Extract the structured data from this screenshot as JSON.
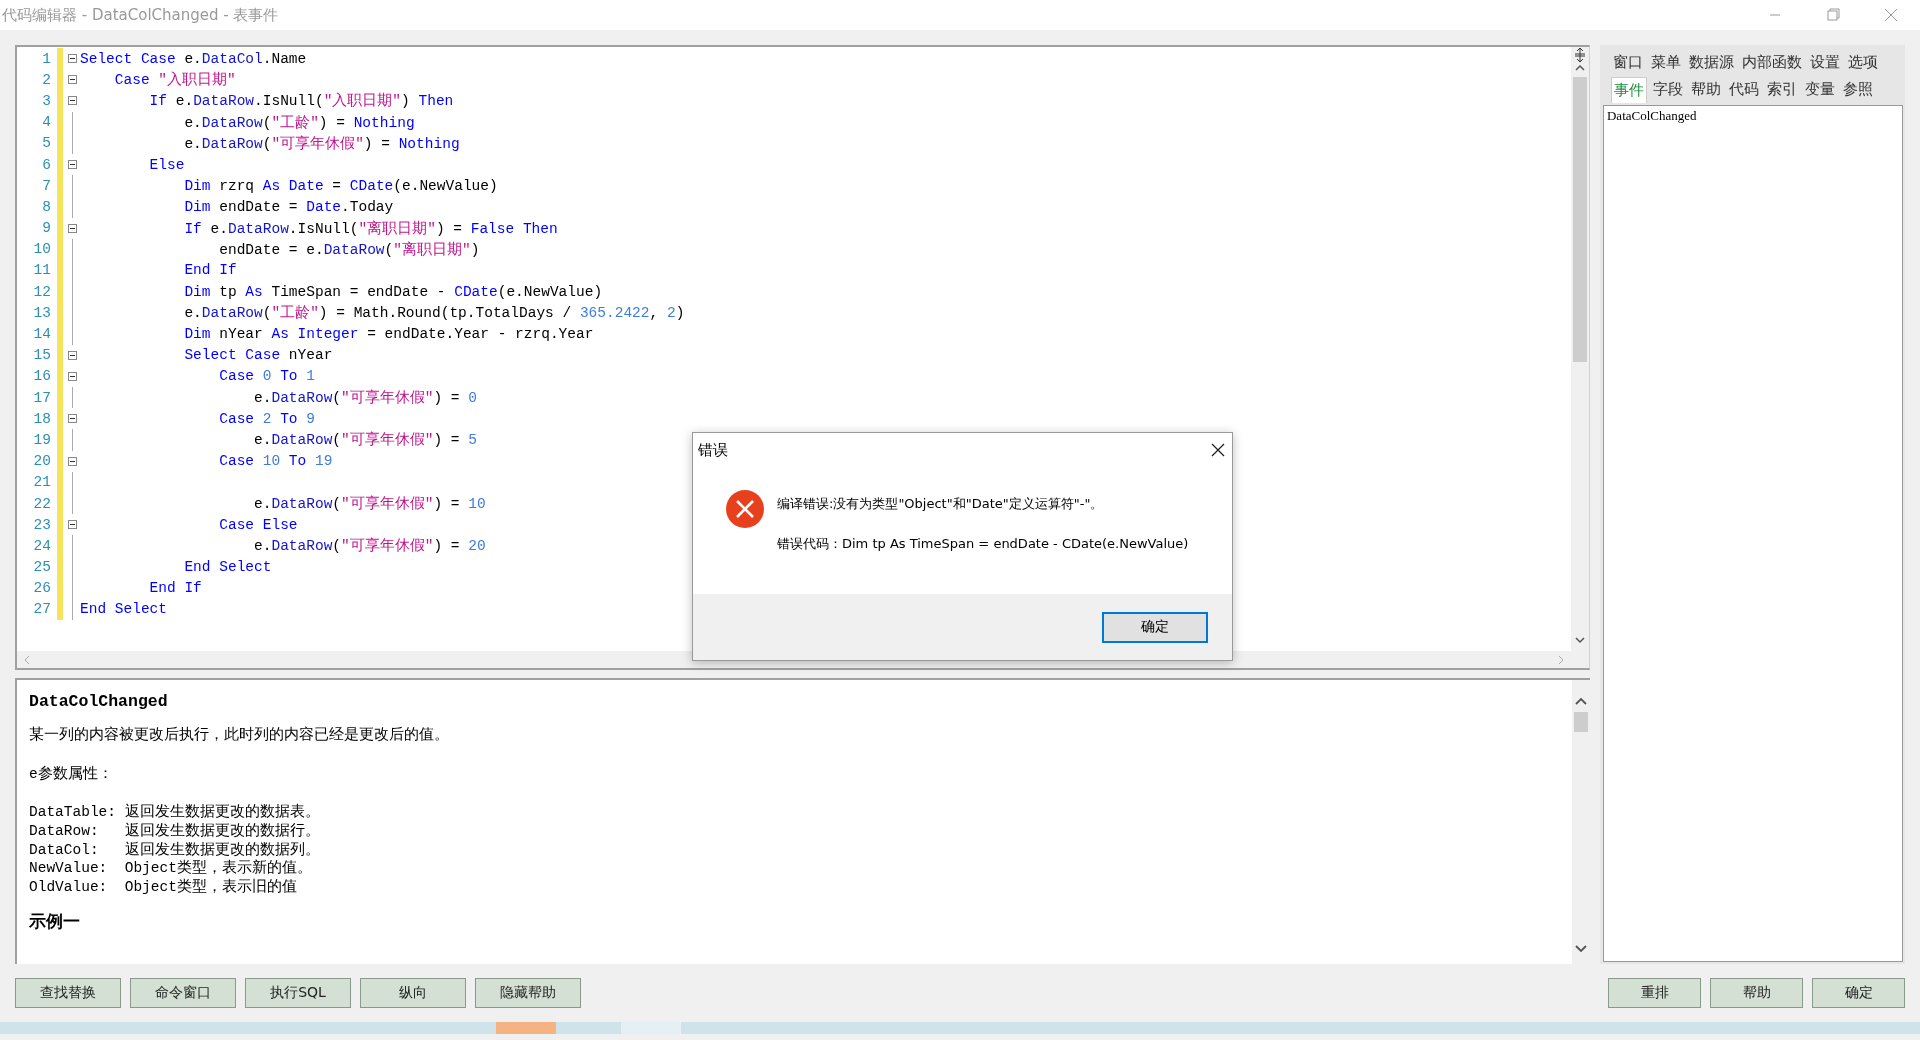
{
  "window": {
    "title": "代码编辑器 - DataColChanged - 表事件"
  },
  "editor": {
    "lines": [
      {
        "number": "1",
        "fold": true,
        "tokens": [
          {
            "kind": "keyword",
            "text": "Select Case"
          },
          {
            "kind": "plain",
            "text": " e."
          },
          {
            "kind": "member",
            "text": "DataCol"
          },
          {
            "kind": "plain",
            "text": ".Name"
          }
        ]
      },
      {
        "number": "2",
        "fold": true,
        "tokens": [
          {
            "kind": "keyword",
            "text": "    Case"
          },
          {
            "kind": "string",
            "text": " \"入职日期\""
          }
        ]
      },
      {
        "number": "3",
        "fold": true,
        "tokens": [
          {
            "kind": "keyword",
            "text": "        If"
          },
          {
            "kind": "plain",
            "text": " e."
          },
          {
            "kind": "member",
            "text": "DataRow"
          },
          {
            "kind": "plain",
            "text": ".IsNull("
          },
          {
            "kind": "string",
            "text": "\"入职日期\""
          },
          {
            "kind": "plain",
            "text": ") "
          },
          {
            "kind": "keyword",
            "text": "Then"
          }
        ]
      },
      {
        "number": "4",
        "fold": false,
        "tokens": [
          {
            "kind": "plain",
            "text": "            e."
          },
          {
            "kind": "member",
            "text": "DataRow"
          },
          {
            "kind": "plain",
            "text": "("
          },
          {
            "kind": "string",
            "text": "\"工龄\""
          },
          {
            "kind": "plain",
            "text": ") = "
          },
          {
            "kind": "keyword",
            "text": "Nothing"
          }
        ]
      },
      {
        "number": "5",
        "fold": false,
        "tokens": [
          {
            "kind": "plain",
            "text": "            e."
          },
          {
            "kind": "member",
            "text": "DataRow"
          },
          {
            "kind": "plain",
            "text": "("
          },
          {
            "kind": "string",
            "text": "\"可享年休假\""
          },
          {
            "kind": "plain",
            "text": ") = "
          },
          {
            "kind": "keyword",
            "text": "Nothing"
          }
        ]
      },
      {
        "number": "6",
        "fold": true,
        "tokens": [
          {
            "kind": "keyword",
            "text": "        Else"
          }
        ]
      },
      {
        "number": "7",
        "fold": false,
        "tokens": [
          {
            "kind": "keyword",
            "text": "            Dim"
          },
          {
            "kind": "plain",
            "text": " rzrq "
          },
          {
            "kind": "keyword",
            "text": "As Date"
          },
          {
            "kind": "plain",
            "text": " = "
          },
          {
            "kind": "keyword",
            "text": "CDate"
          },
          {
            "kind": "plain",
            "text": "(e.NewValue)"
          }
        ]
      },
      {
        "number": "8",
        "fold": false,
        "tokens": [
          {
            "kind": "keyword",
            "text": "            Dim"
          },
          {
            "kind": "plain",
            "text": " endDate = "
          },
          {
            "kind": "keyword",
            "text": "Date"
          },
          {
            "kind": "plain",
            "text": ".Today"
          }
        ]
      },
      {
        "number": "9",
        "fold": true,
        "tokens": [
          {
            "kind": "keyword",
            "text": "            If"
          },
          {
            "kind": "plain",
            "text": " e."
          },
          {
            "kind": "member",
            "text": "DataRow"
          },
          {
            "kind": "plain",
            "text": ".IsNull("
          },
          {
            "kind": "string",
            "text": "\"离职日期\""
          },
          {
            "kind": "plain",
            "text": ") = "
          },
          {
            "kind": "keyword",
            "text": "False Then"
          }
        ]
      },
      {
        "number": "10",
        "fold": false,
        "tokens": [
          {
            "kind": "plain",
            "text": "                endDate = e."
          },
          {
            "kind": "member",
            "text": "DataRow"
          },
          {
            "kind": "plain",
            "text": "("
          },
          {
            "kind": "string",
            "text": "\"离职日期\""
          },
          {
            "kind": "plain",
            "text": ")"
          }
        ]
      },
      {
        "number": "11",
        "fold": false,
        "tokens": [
          {
            "kind": "keyword",
            "text": "            End If"
          }
        ]
      },
      {
        "number": "12",
        "fold": false,
        "tokens": [
          {
            "kind": "keyword",
            "text": "            Dim"
          },
          {
            "kind": "plain",
            "text": " tp "
          },
          {
            "kind": "keyword",
            "text": "As"
          },
          {
            "kind": "plain",
            "text": " TimeSpan = endDate - "
          },
          {
            "kind": "keyword",
            "text": "CDate"
          },
          {
            "kind": "plain",
            "text": "(e.NewValue)"
          }
        ]
      },
      {
        "number": "13",
        "fold": false,
        "tokens": [
          {
            "kind": "plain",
            "text": "            e."
          },
          {
            "kind": "member",
            "text": "DataRow"
          },
          {
            "kind": "plain",
            "text": "("
          },
          {
            "kind": "string",
            "text": "\"工龄\""
          },
          {
            "kind": "plain",
            "text": ") = Math.Round(tp.TotalDays / "
          },
          {
            "kind": "number",
            "text": "365.2422"
          },
          {
            "kind": "plain",
            "text": ", "
          },
          {
            "kind": "number",
            "text": "2"
          },
          {
            "kind": "plain",
            "text": ")"
          }
        ]
      },
      {
        "number": "14",
        "fold": false,
        "tokens": [
          {
            "kind": "keyword",
            "text": "            Dim"
          },
          {
            "kind": "plain",
            "text": " nYear "
          },
          {
            "kind": "keyword",
            "text": "As Integer"
          },
          {
            "kind": "plain",
            "text": " = endDate.Year - rzrq.Year"
          }
        ]
      },
      {
        "number": "15",
        "fold": true,
        "tokens": [
          {
            "kind": "keyword",
            "text": "            Select Case"
          },
          {
            "kind": "plain",
            "text": " nYear"
          }
        ]
      },
      {
        "number": "16",
        "fold": true,
        "tokens": [
          {
            "kind": "keyword",
            "text": "                Case"
          },
          {
            "kind": "number",
            "text": " 0"
          },
          {
            "kind": "keyword",
            "text": " To"
          },
          {
            "kind": "number",
            "text": " 1"
          }
        ]
      },
      {
        "number": "17",
        "fold": false,
        "tokens": [
          {
            "kind": "plain",
            "text": "                    e."
          },
          {
            "kind": "member",
            "text": "DataRow"
          },
          {
            "kind": "plain",
            "text": "("
          },
          {
            "kind": "string",
            "text": "\"可享年休假\""
          },
          {
            "kind": "plain",
            "text": ") = "
          },
          {
            "kind": "number",
            "text": "0"
          }
        ]
      },
      {
        "number": "18",
        "fold": true,
        "tokens": [
          {
            "kind": "keyword",
            "text": "                Case"
          },
          {
            "kind": "number",
            "text": " 2"
          },
          {
            "kind": "keyword",
            "text": " To"
          },
          {
            "kind": "number",
            "text": " 9"
          }
        ]
      },
      {
        "number": "19",
        "fold": false,
        "tokens": [
          {
            "kind": "plain",
            "text": "                    e."
          },
          {
            "kind": "member",
            "text": "DataRow"
          },
          {
            "kind": "plain",
            "text": "("
          },
          {
            "kind": "string",
            "text": "\"可享年休假\""
          },
          {
            "kind": "plain",
            "text": ") = "
          },
          {
            "kind": "number",
            "text": "5"
          }
        ]
      },
      {
        "number": "20",
        "fold": true,
        "tokens": [
          {
            "kind": "keyword",
            "text": "                Case"
          },
          {
            "kind": "number",
            "text": " 10"
          },
          {
            "kind": "keyword",
            "text": " To"
          },
          {
            "kind": "number",
            "text": " 19"
          }
        ]
      },
      {
        "number": "21",
        "fold": false
      },
      {
        "number": "22",
        "fold": false,
        "tokens": [
          {
            "kind": "plain",
            "text": "                    e."
          },
          {
            "kind": "member",
            "text": "DataRow"
          },
          {
            "kind": "plain",
            "text": "("
          },
          {
            "kind": "string",
            "text": "\"可享年休假\""
          },
          {
            "kind": "plain",
            "text": ") = "
          },
          {
            "kind": "number",
            "text": "10"
          }
        ]
      },
      {
        "number": "23",
        "fold": true,
        "tokens": [
          {
            "kind": "keyword",
            "text": "                Case Else"
          }
        ]
      },
      {
        "number": "24",
        "fold": false,
        "tokens": [
          {
            "kind": "plain",
            "text": "                    e."
          },
          {
            "kind": "member",
            "text": "DataRow"
          },
          {
            "kind": "plain",
            "text": "("
          },
          {
            "kind": "string",
            "text": "\"可享年休假\""
          },
          {
            "kind": "plain",
            "text": ") = "
          },
          {
            "kind": "number",
            "text": "20"
          }
        ]
      },
      {
        "number": "25",
        "fold": false,
        "tokens": [
          {
            "kind": "keyword",
            "text": "            End Select"
          }
        ]
      },
      {
        "number": "26",
        "fold": false,
        "tokens": [
          {
            "kind": "keyword",
            "text": "        End If"
          }
        ]
      },
      {
        "number": "27",
        "fold": false,
        "tokens": [
          {
            "kind": "keyword",
            "text": "End Select"
          }
        ]
      }
    ]
  },
  "help": {
    "blocks": [
      {
        "kind": "heading",
        "text": "DataColChanged"
      },
      {
        "kind": "paragraph",
        "text": "某一列的内容被更改后执行，此时列的内容已经是更改后的值。"
      },
      {
        "kind": "paragraph",
        "text": "e参数属性："
      },
      {
        "kind": "property",
        "text": "DataTable: 返回发生数据更改的数据表。"
      },
      {
        "kind": "property",
        "text": "DataRow:   返回发生数据更改的数据行。"
      },
      {
        "kind": "property",
        "text": "DataCol:   返回发生数据更改的数据列。"
      },
      {
        "kind": "property",
        "text": "NewValue:  Object类型，表示新的值。"
      },
      {
        "kind": "property",
        "text": "OldValue:  Object类型，表示旧的值"
      },
      {
        "kind": "heading",
        "text": "示例一"
      }
    ]
  },
  "sidebar": {
    "tab_rows": [
      [
        {
          "label": "窗口",
          "selected": false
        },
        {
          "label": "菜单",
          "selected": false
        },
        {
          "label": "数据源",
          "selected": false
        },
        {
          "label": "内部函数",
          "selected": false
        },
        {
          "label": "设置",
          "selected": false
        },
        {
          "label": "选项",
          "selected": false
        }
      ],
      [
        {
          "label": "事件",
          "selected": true
        },
        {
          "label": "字段",
          "selected": false
        },
        {
          "label": "帮助",
          "selected": false
        },
        {
          "label": "代码",
          "selected": false
        },
        {
          "label": "索引",
          "selected": false
        },
        {
          "label": "变量",
          "selected": false
        },
        {
          "label": "参照",
          "selected": false
        }
      ]
    ],
    "items": [
      {
        "label": "DataColChanged",
        "selected": false
      }
    ]
  },
  "left_buttons": [
    "查找替换",
    "命令窗口",
    "执行SQL",
    "纵向",
    "隐藏帮助"
  ],
  "right_buttons": [
    "重排",
    "帮助",
    "确定"
  ],
  "dialog": {
    "title": "错误",
    "message": "编译错误:没有为类型\"Object\"和\"Date\"定义运算符\"-\"。",
    "detail": "错误代码：Dim tp As TimeSpan = endDate - CDate(e.NewValue)",
    "button": "确定"
  }
}
